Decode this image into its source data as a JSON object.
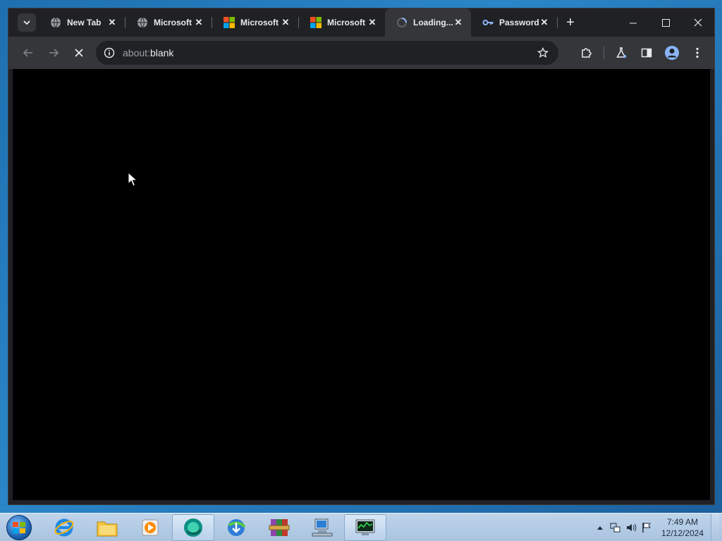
{
  "browser": {
    "tabs": [
      {
        "title": "New Tab",
        "icon": "globe-icon"
      },
      {
        "title": "Microsoft",
        "icon": "globe-icon"
      },
      {
        "title": "Microsoft",
        "icon": "microsoft-logo-icon"
      },
      {
        "title": "Microsoft",
        "icon": "microsoft-logo-icon"
      },
      {
        "title": "Loading...",
        "icon": "loading-spinner-icon",
        "active": true
      },
      {
        "title": "Passwords",
        "icon": "key-icon"
      }
    ],
    "address_bar": {
      "prefix": "about:",
      "value": "blank"
    }
  },
  "taskbar": {
    "pinned": [
      "internet-explorer-icon",
      "file-explorer-icon",
      "media-player-icon",
      "chromium-browser-icon",
      "download-manager-icon",
      "winrar-icon",
      "network-computer-icon",
      "task-manager-icon"
    ],
    "active_items": [
      "chromium-browser-icon",
      "task-manager-icon"
    ],
    "clock": {
      "time": "7:49 AM",
      "date": "12/12/2024"
    }
  },
  "colors": {
    "chrome_dark": "#202124",
    "toolbar": "#35363a",
    "text": "#e8eaed",
    "accent_blue": "#8ab4f8"
  }
}
